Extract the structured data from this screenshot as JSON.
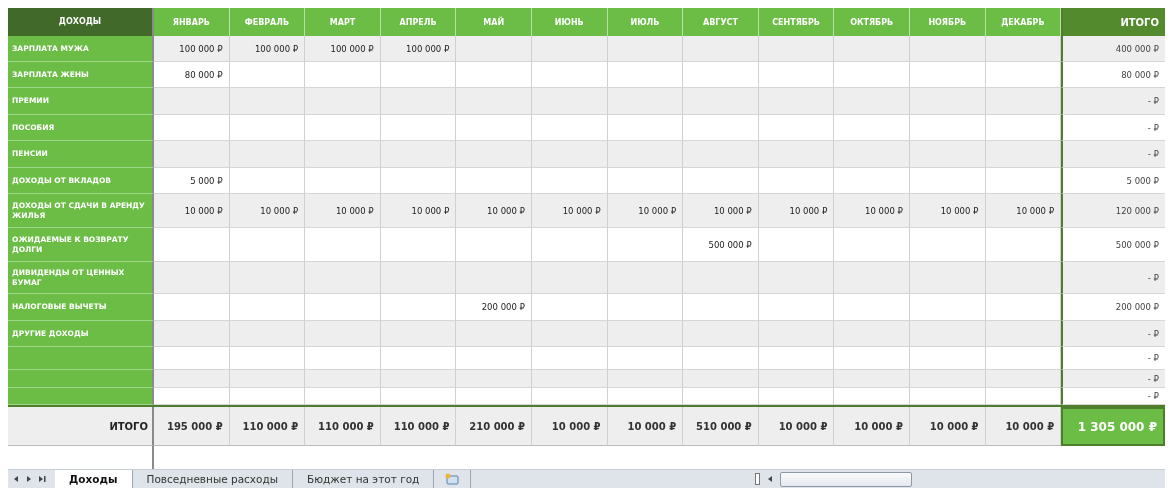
{
  "header": {
    "label": "ДОХОДЫ",
    "months": [
      "ЯНВАРЬ",
      "ФЕВРАЛЬ",
      "МАРТ",
      "АПРЕЛЬ",
      "МАЙ",
      "ИЮНЬ",
      "ИЮЛЬ",
      "АВГУСТ",
      "СЕНТЯБРЬ",
      "ОКТЯБРЬ",
      "НОЯБРЬ",
      "ДЕКАБРЬ"
    ],
    "total": "ИТОГО"
  },
  "rows": [
    {
      "label": "ЗАРПЛАТА МУЖА",
      "cells": [
        "100 000 ₽",
        "100 000 ₽",
        "100 000 ₽",
        "100 000 ₽",
        null,
        null,
        null,
        null,
        null,
        null,
        null,
        null
      ],
      "total": "400 000 ₽"
    },
    {
      "label": "ЗАРПЛАТА ЖЕНЫ",
      "cells": [
        "80 000 ₽",
        null,
        null,
        null,
        null,
        null,
        null,
        null,
        null,
        null,
        null,
        null
      ],
      "total": "80 000 ₽"
    },
    {
      "label": "ПРЕМИИ",
      "cells": [
        null,
        null,
        null,
        null,
        null,
        null,
        null,
        null,
        null,
        null,
        null,
        null
      ],
      "total": "-  ₽"
    },
    {
      "label": "ПОСОБИЯ",
      "cells": [
        null,
        null,
        null,
        null,
        null,
        null,
        null,
        null,
        null,
        null,
        null,
        null
      ],
      "total": "-  ₽"
    },
    {
      "label": "ПЕНСИИ",
      "cells": [
        null,
        null,
        null,
        null,
        null,
        null,
        null,
        null,
        null,
        null,
        null,
        null
      ],
      "total": "-  ₽"
    },
    {
      "label": "ДОХОДЫ ОТ ВКЛАДОВ",
      "cells": [
        "5 000 ₽",
        null,
        null,
        null,
        null,
        null,
        null,
        null,
        null,
        null,
        null,
        null
      ],
      "total": "5 000 ₽"
    },
    {
      "label": "ДОХОДЫ ОТ СДАЧИ В АРЕНДУ ЖИЛЬЯ",
      "cells": [
        "10 000 ₽",
        "10 000 ₽",
        "10 000 ₽",
        "10 000 ₽",
        "10 000 ₽",
        "10 000 ₽",
        "10 000 ₽",
        "10 000 ₽",
        "10 000 ₽",
        "10 000 ₽",
        "10 000 ₽",
        "10 000 ₽"
      ],
      "total": "120 000 ₽"
    },
    {
      "label": "ОЖИДАЕМЫЕ К ВОЗВРАТУ ДОЛГИ",
      "cells": [
        null,
        null,
        null,
        null,
        null,
        null,
        null,
        "500 000 ₽",
        null,
        null,
        null,
        null
      ],
      "total": "500 000 ₽"
    },
    {
      "label": "ДИВИДЕНДЫ ОТ ЦЕННЫХ БУМАГ",
      "cells": [
        null,
        null,
        null,
        null,
        null,
        null,
        null,
        null,
        null,
        null,
        null,
        null
      ],
      "total": "-  ₽"
    },
    {
      "label": "НАЛОГОВЫЕ ВЫЧЕТЫ",
      "cells": [
        null,
        null,
        null,
        null,
        "200 000 ₽",
        null,
        null,
        null,
        null,
        null,
        null,
        null
      ],
      "total": "200 000 ₽"
    },
    {
      "label": "ДРУГИЕ ДОХОДЫ",
      "cells": [
        null,
        null,
        null,
        null,
        null,
        null,
        null,
        null,
        null,
        null,
        null,
        null
      ],
      "total": "-  ₽"
    },
    {
      "cells": [
        null,
        null,
        null,
        null,
        null,
        null,
        null,
        null,
        null,
        null,
        null,
        null
      ],
      "total": "-  ₽"
    },
    {
      "cells": [
        null,
        null,
        null,
        null,
        null,
        null,
        null,
        null,
        null,
        null,
        null,
        null
      ],
      "total": "-  ₽"
    },
    {
      "cells": [
        null,
        null,
        null,
        null,
        null,
        null,
        null,
        null,
        null,
        null,
        null,
        null
      ],
      "total": "-  ₽"
    }
  ],
  "totals": {
    "label": "ИТОГО",
    "cells": [
      "195 000 ₽",
      "110 000 ₽",
      "110 000 ₽",
      "110 000 ₽",
      "210 000 ₽",
      "10 000 ₽",
      "10 000 ₽",
      "510 000 ₽",
      "10 000 ₽",
      "10 000 ₽",
      "10 000 ₽",
      "10 000 ₽"
    ],
    "grand_total": "1 305 000 ₽"
  },
  "sheet_tabs": [
    {
      "label": "Доходы",
      "selected": true
    },
    {
      "label": "Повседневные расходы",
      "selected": false
    },
    {
      "label": "Бюджет на этот год",
      "selected": false
    }
  ]
}
